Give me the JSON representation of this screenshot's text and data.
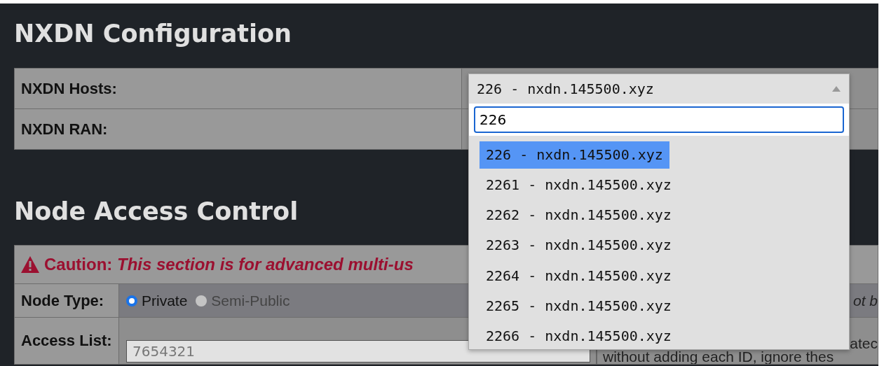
{
  "sections": [
    {
      "title": "NXDN Configuration",
      "rows": [
        {
          "label": "NXDN Hosts:"
        },
        {
          "label": "NXDN RAN:"
        }
      ]
    },
    {
      "title": "Node Access Control",
      "caution": {
        "label": "Caution:",
        "text": "This section is for advanced multi-us"
      },
      "node_type": {
        "label": "Node Type:",
        "options": [
          {
            "label": "Private",
            "selected": true
          },
          {
            "label": "Semi-Public",
            "selected": false
          }
        ],
        "help": "ot b"
      },
      "access_list": {
        "label": "Access List:",
        "placeholder": "7654321",
        "help": [
          "atec",
          "without adding each ID, ignore thes"
        ]
      }
    }
  ],
  "dropdown": {
    "value": "226 - nxdn.145500.xyz",
    "search": "226",
    "expanded": true,
    "options": [
      {
        "label": "226 - nxdn.145500.xyz",
        "selected": true
      },
      {
        "label": "2261 - nxdn.145500.xyz",
        "selected": false
      },
      {
        "label": "2262 - nxdn.145500.xyz",
        "selected": false
      },
      {
        "label": "2263 - nxdn.145500.xyz",
        "selected": false
      },
      {
        "label": "2264 - nxdn.145500.xyz",
        "selected": false
      },
      {
        "label": "2265 - nxdn.145500.xyz",
        "selected": false
      },
      {
        "label": "2266 - nxdn.145500.xyz",
        "selected": false
      }
    ]
  }
}
